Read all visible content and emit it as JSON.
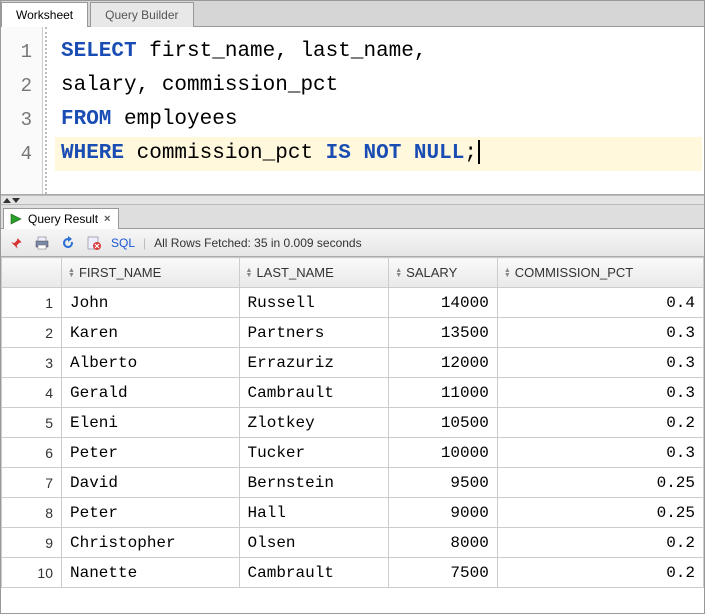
{
  "tabs": {
    "worksheet": "Worksheet",
    "queryBuilder": "Query Builder"
  },
  "code": {
    "lines": [
      {
        "n": "1",
        "tokens": [
          {
            "cls": "kw",
            "t": "SELECT"
          },
          {
            "cls": "txt",
            "t": " first_name, last_name,"
          }
        ]
      },
      {
        "n": "2",
        "tokens": [
          {
            "cls": "txt",
            "t": "salary, commission_pct"
          }
        ]
      },
      {
        "n": "3",
        "tokens": [
          {
            "cls": "kw",
            "t": "FROM"
          },
          {
            "cls": "txt",
            "t": " employees"
          }
        ]
      },
      {
        "n": "4",
        "hl": true,
        "tokens": [
          {
            "cls": "kw",
            "t": "WHERE"
          },
          {
            "cls": "txt",
            "t": " commission_pct "
          },
          {
            "cls": "kw",
            "t": "IS"
          },
          {
            "cls": "txt",
            "t": " "
          },
          {
            "cls": "kw",
            "t": "NOT"
          },
          {
            "cls": "txt",
            "t": " "
          },
          {
            "cls": "kw",
            "t": "NULL"
          },
          {
            "cls": "txt",
            "t": ";"
          }
        ],
        "cursor": true
      }
    ]
  },
  "resultTab": {
    "label": "Query Result",
    "close": "×"
  },
  "toolbar": {
    "sql": "SQL",
    "status": "All Rows Fetched: 35 in 0.009 seconds"
  },
  "columns": [
    {
      "label": "FIRST_NAME",
      "align": "left"
    },
    {
      "label": "LAST_NAME",
      "align": "left"
    },
    {
      "label": "SALARY",
      "align": "right"
    },
    {
      "label": "COMMISSION_PCT",
      "align": "right"
    }
  ],
  "rows": [
    {
      "n": "1",
      "c": [
        "John",
        "Russell",
        "14000",
        "0.4"
      ]
    },
    {
      "n": "2",
      "c": [
        "Karen",
        "Partners",
        "13500",
        "0.3"
      ]
    },
    {
      "n": "3",
      "c": [
        "Alberto",
        "Errazuriz",
        "12000",
        "0.3"
      ]
    },
    {
      "n": "4",
      "c": [
        "Gerald",
        "Cambrault",
        "11000",
        "0.3"
      ]
    },
    {
      "n": "5",
      "c": [
        "Eleni",
        "Zlotkey",
        "10500",
        "0.2"
      ]
    },
    {
      "n": "6",
      "c": [
        "Peter",
        "Tucker",
        "10000",
        "0.3"
      ]
    },
    {
      "n": "7",
      "c": [
        "David",
        "Bernstein",
        "9500",
        "0.25"
      ]
    },
    {
      "n": "8",
      "c": [
        "Peter",
        "Hall",
        "9000",
        "0.25"
      ]
    },
    {
      "n": "9",
      "c": [
        "Christopher",
        "Olsen",
        "8000",
        "0.2"
      ]
    },
    {
      "n": "10",
      "c": [
        "Nanette",
        "Cambrault",
        "7500",
        "0.2"
      ]
    }
  ]
}
